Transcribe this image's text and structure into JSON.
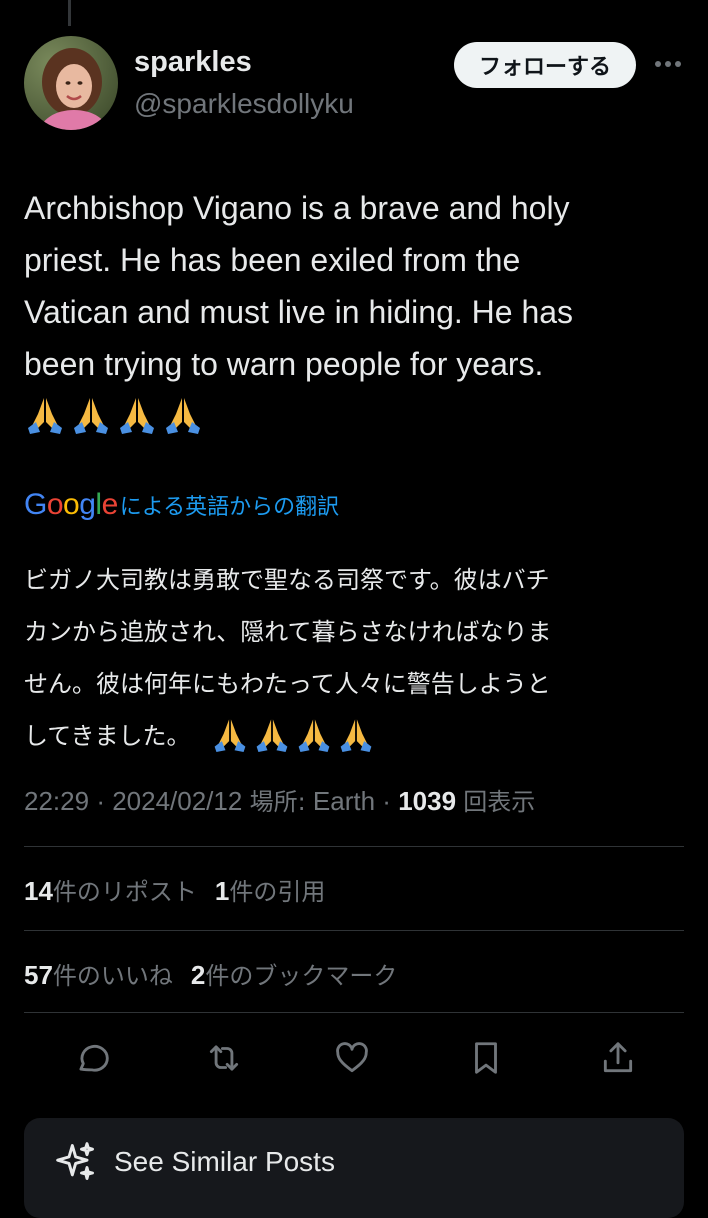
{
  "author": {
    "name": "sparkles",
    "handle": "@sparklesdollyku",
    "follow_label": "フォローする"
  },
  "tweet": {
    "lines": [
      "Archbishop Vigano is a brave and holy",
      "priest. He has been exiled from the",
      "Vatican and must live in hiding. He has",
      "been trying to warn people for years."
    ],
    "emoji": [
      "🙏",
      "🙏",
      "🙏",
      "🙏"
    ]
  },
  "translation": {
    "provider": "Google",
    "label": "による英語からの翻訳",
    "lines": [
      "ビガノ大司教は勇敢で聖なる司祭です。彼はバチ",
      "カンから追放され、隠れて暮らさなければなりま",
      "せん。彼は何年にもわたって人々に警告しようと",
      "してきました。"
    ],
    "emoji": [
      "🙏",
      "🙏",
      "🙏",
      "🙏"
    ]
  },
  "meta": {
    "time": "22:29",
    "date": "2024/02/12",
    "location_label": "場所:",
    "location": "Earth",
    "views": "1039",
    "views_label": "回表示"
  },
  "stats": {
    "reposts": "14",
    "reposts_label": "件のリポスト",
    "quotes": "1",
    "quotes_label": "件の引用",
    "likes": "57",
    "likes_label": "件のいいね",
    "bookmarks": "2",
    "bookmarks_label": "件のブックマーク"
  },
  "actions": [
    "reply-icon",
    "repost-icon",
    "like-icon",
    "bookmark-icon",
    "share-icon"
  ],
  "see_similar_label": "See Similar Posts",
  "colors": {
    "background": "#000000",
    "text": "#e7e9ea",
    "muted": "#71767b",
    "link": "#1d9bf0",
    "divider": "#2f3336"
  }
}
